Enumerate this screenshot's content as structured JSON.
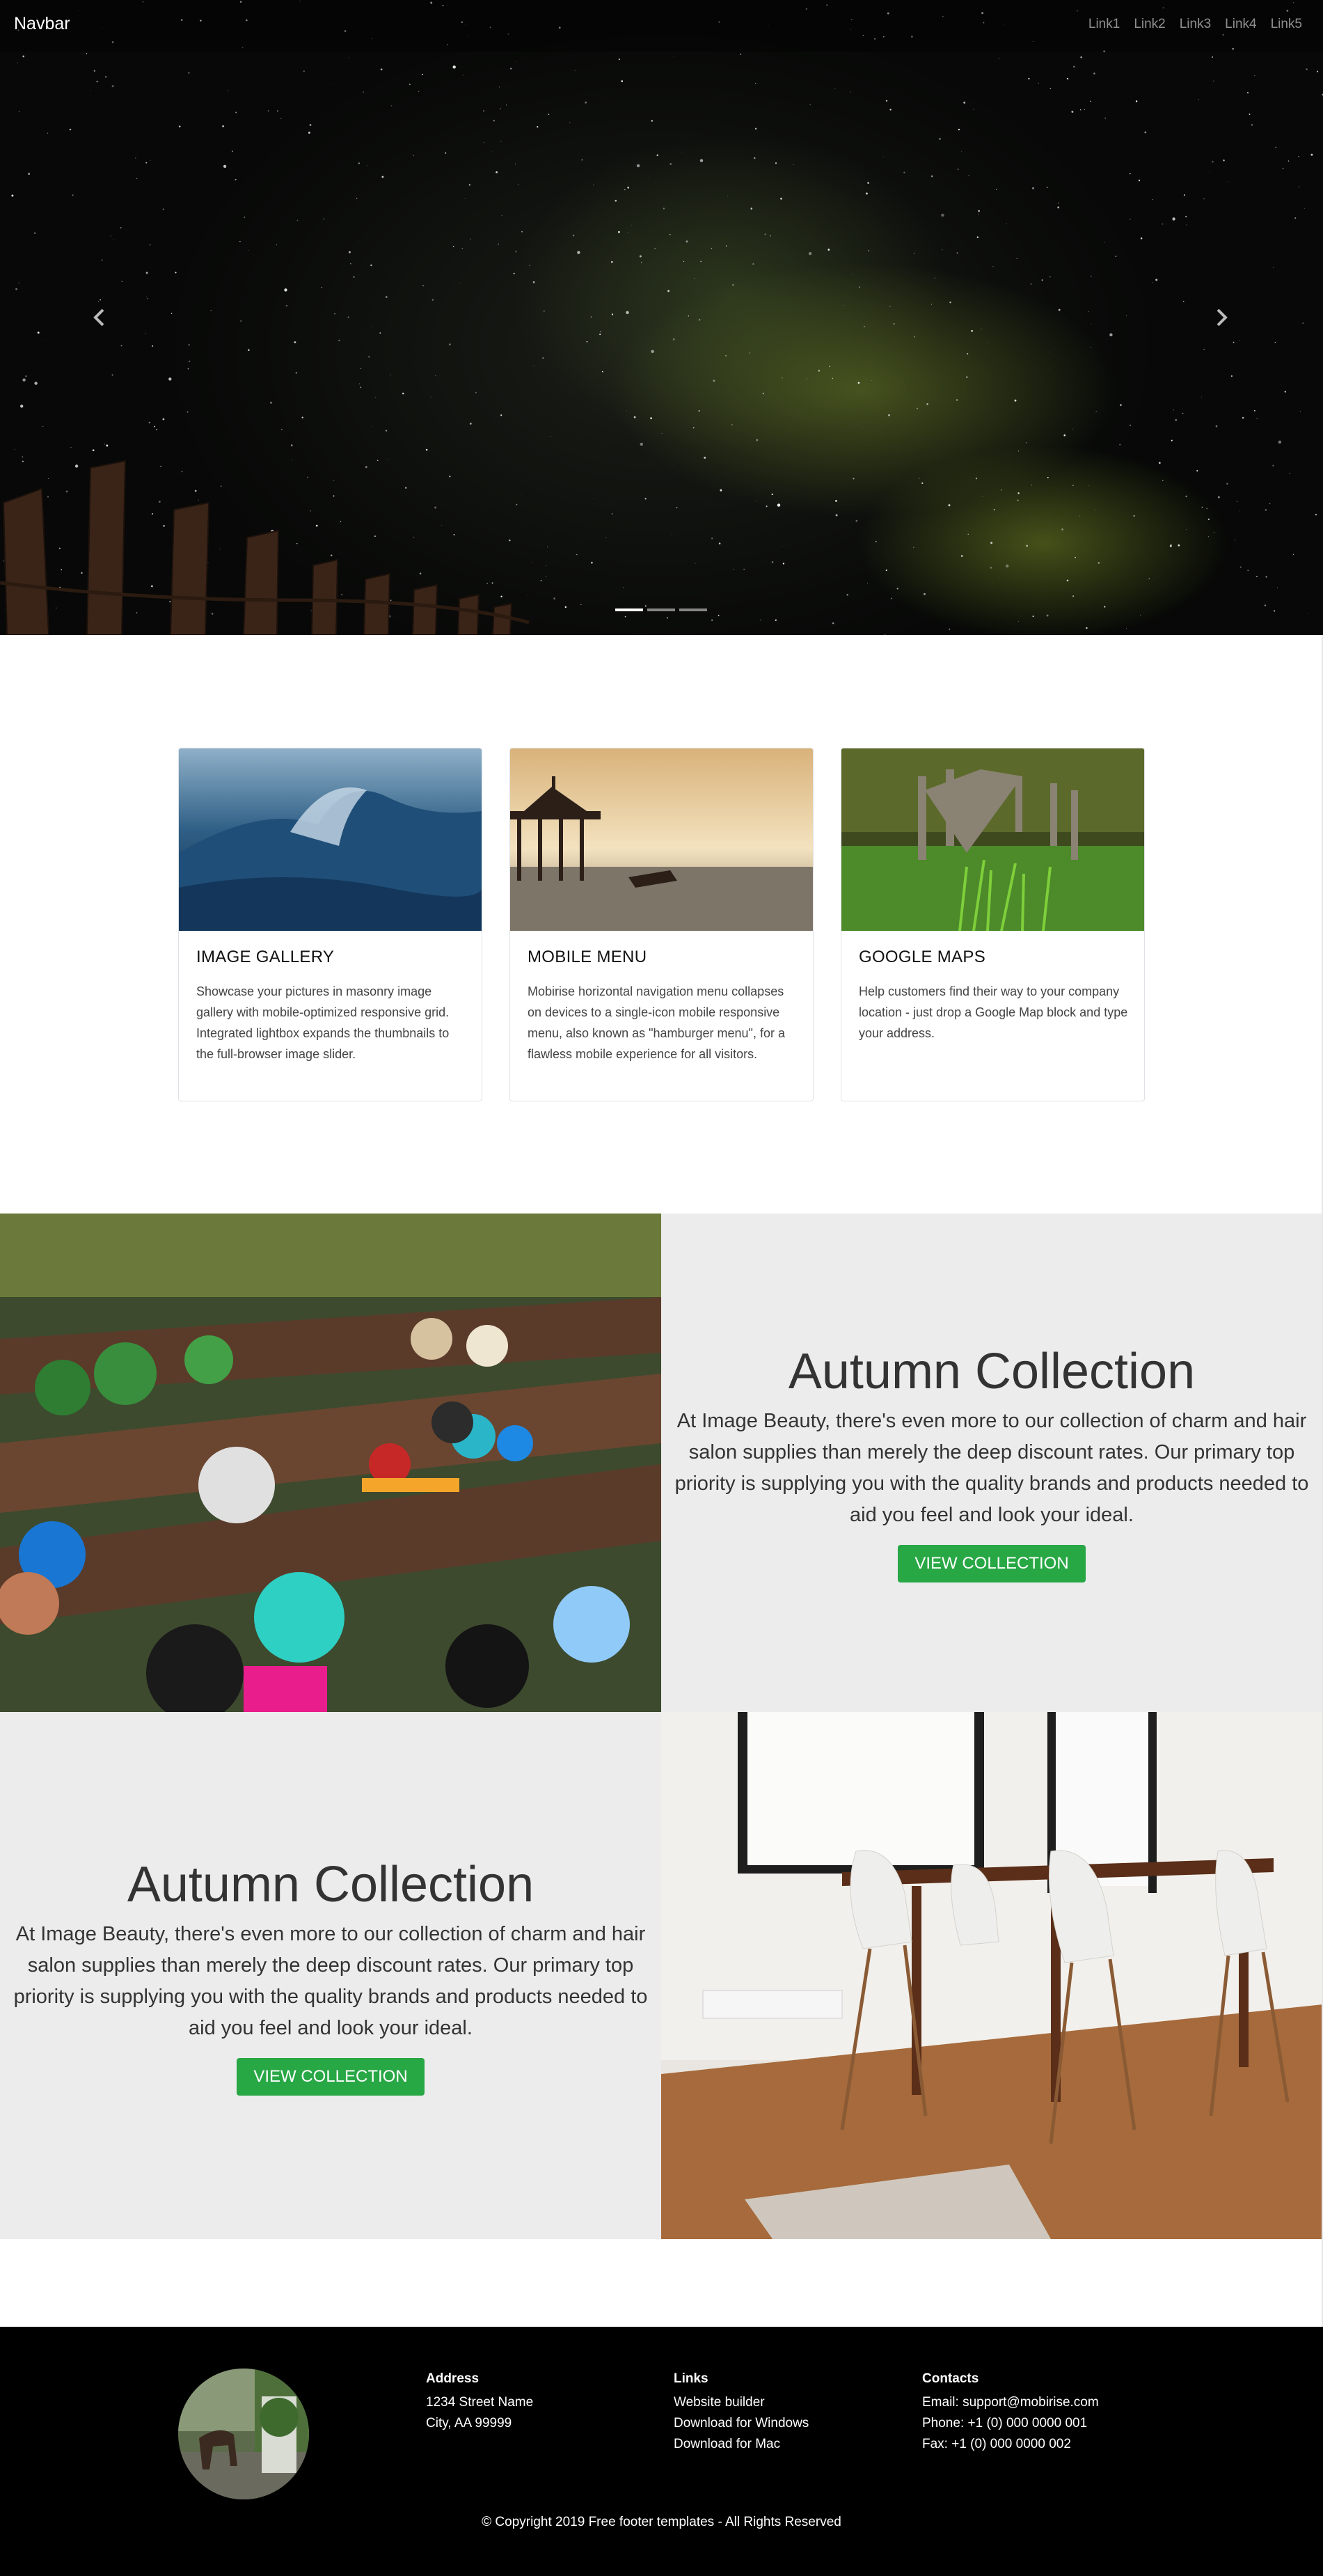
{
  "navbar": {
    "brand": "Navbar",
    "links": [
      "Link1",
      "Link2",
      "Link3",
      "Link4",
      "Link5"
    ]
  },
  "carousel": {
    "prev_icon": "chevron-left-icon",
    "next_icon": "chevron-right-icon",
    "slide_count": 3,
    "active_slide": 1
  },
  "cards": [
    {
      "title": "IMAGE GALLERY",
      "text": "Showcase your pictures in masonry image gallery with mobile-optimized responsive grid. Integrated lightbox expands the thumbnails to the full-browser image slider."
    },
    {
      "title": "MOBILE MENU",
      "text": "Mobirise horizontal navigation menu collapses on devices to a single-icon mobile responsive menu, also known as \"hamburger menu\", for a flawless mobile experience for all visitors."
    },
    {
      "title": "GOOGLE MAPS",
      "text": "Help customers find their way to your company location - just drop a Google Map block and type your address."
    }
  ],
  "features": [
    {
      "title": "Autumn Collection",
      "text": "At Image Beauty, there's even more to our collection of charm and hair salon supplies than merely the deep discount rates. Our primary top priority is supplying you with the quality brands and products needed to aid you feel and look your ideal.",
      "button": "VIEW COLLECTION"
    },
    {
      "title": "Autumn Collection",
      "text": "At Image Beauty, there's even more to our collection of charm and hair salon supplies than merely the deep discount rates. Our primary top priority is supplying you with the quality brands and products needed to aid you feel and look your ideal.",
      "button": "VIEW COLLECTION"
    }
  ],
  "footer": {
    "address": {
      "heading": "Address",
      "line1": "1234 Street Name",
      "line2": "City, AA 99999"
    },
    "links": {
      "heading": "Links",
      "items": [
        "Website builder",
        "Download for Windows",
        "Download for Mac"
      ]
    },
    "contacts": {
      "heading": "Contacts",
      "email": "Email: support@mobirise.com",
      "phone": "Phone: +1 (0) 000 0000 001",
      "fax": "Fax: +1 (0) 000 0000 002"
    },
    "copyright": "© Copyright 2019 Free footer templates - All Rights Reserved"
  },
  "colors": {
    "button_green": "#28a745",
    "feature_bg": "#ececed",
    "footer_bg": "#000000"
  }
}
